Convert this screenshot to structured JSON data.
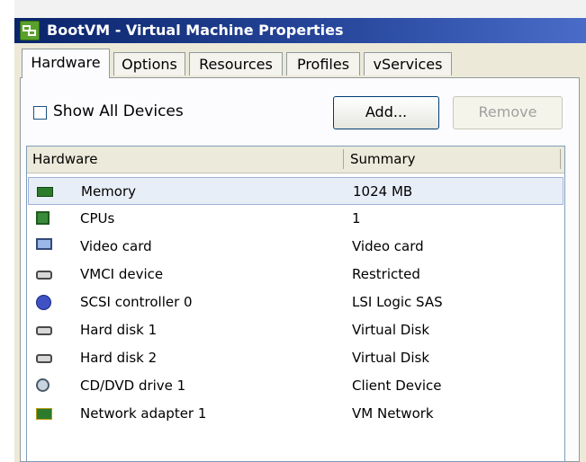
{
  "window": {
    "title": "BootVM - Virtual Machine Properties"
  },
  "tabs": [
    {
      "label": "Hardware",
      "active": true
    },
    {
      "label": "Options",
      "active": false
    },
    {
      "label": "Resources",
      "active": false
    },
    {
      "label": "Profiles",
      "active": false
    },
    {
      "label": "vServices",
      "active": false
    }
  ],
  "toolbar": {
    "show_all_label": "Show All Devices",
    "show_all_checked": false,
    "add_label": "Add...",
    "remove_label": "Remove"
  },
  "table": {
    "columns": [
      "Hardware",
      "Summary"
    ],
    "rows": [
      {
        "name": "Memory",
        "summary": "1024 MB",
        "icon": "memory-icon",
        "selected": true
      },
      {
        "name": "CPUs",
        "summary": "1",
        "icon": "cpu-icon",
        "selected": false
      },
      {
        "name": "Video card",
        "summary": "Video card",
        "icon": "monitor-icon",
        "selected": false
      },
      {
        "name": "VMCI device",
        "summary": "Restricted",
        "icon": "device-icon",
        "selected": false
      },
      {
        "name": "SCSI controller 0",
        "summary": "LSI Logic SAS",
        "icon": "scsi-controller-icon",
        "selected": false
      },
      {
        "name": "Hard disk 1",
        "summary": "Virtual Disk",
        "icon": "hard-disk-icon",
        "selected": false
      },
      {
        "name": "Hard disk 2",
        "summary": "Virtual Disk",
        "icon": "hard-disk-icon",
        "selected": false
      },
      {
        "name": "CD/DVD drive 1",
        "summary": "Client Device",
        "icon": "cd-drive-icon",
        "selected": false
      },
      {
        "name": "Network adapter 1",
        "summary": "VM Network",
        "icon": "network-adapter-icon",
        "selected": false
      }
    ]
  },
  "colors": {
    "title_bar": "#0a246a",
    "selection": "#e8eef8",
    "window_bg": "#ece9d8"
  }
}
